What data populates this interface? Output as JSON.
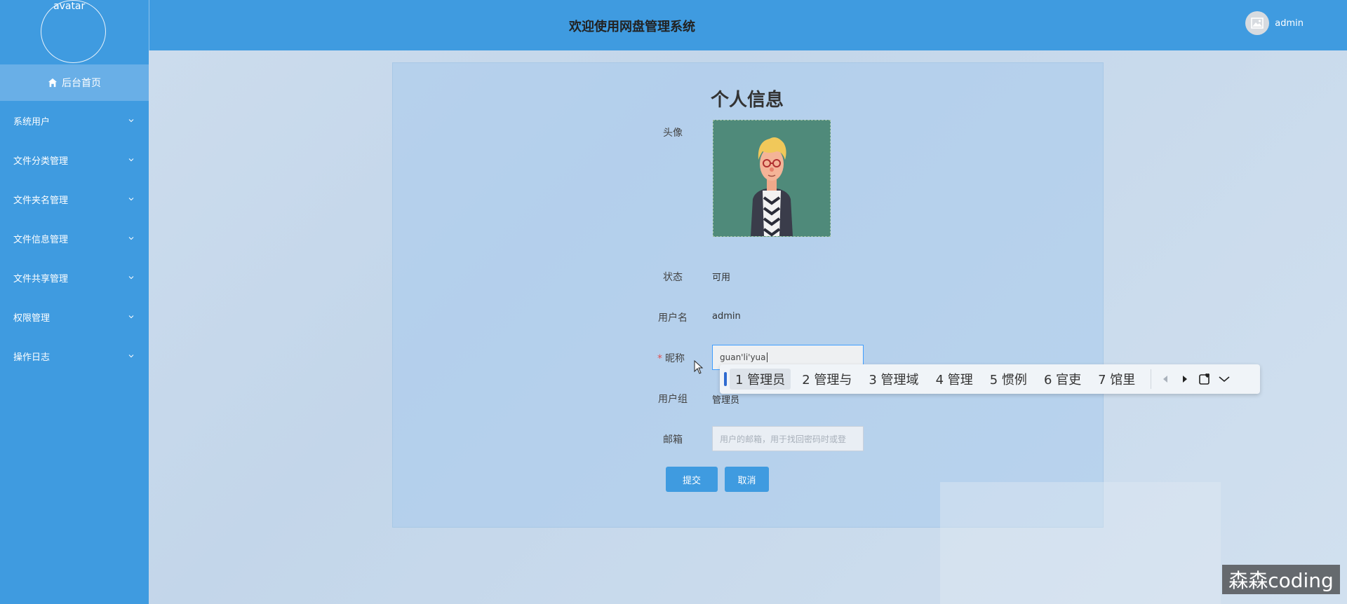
{
  "sidebar": {
    "avatar_alt": "avatar",
    "home_label": "后台首页",
    "items": [
      {
        "label": "系统用户"
      },
      {
        "label": "文件分类管理"
      },
      {
        "label": "文件夹名管理"
      },
      {
        "label": "文件信息管理"
      },
      {
        "label": "文件共享管理"
      },
      {
        "label": "权限管理"
      },
      {
        "label": "操作日志"
      }
    ]
  },
  "header": {
    "title": "欢迎使用网盘管理系统",
    "username": "admin"
  },
  "profile": {
    "title": "个人信息",
    "avatar_label": "头像",
    "status_label": "状态",
    "status_value": "可用",
    "username_label": "用户名",
    "username_value": "admin",
    "nickname_required_mark": "*",
    "nickname_label": "昵称",
    "nickname_value": "guan'li'yua",
    "group_label": "用户组",
    "group_value": "管理员",
    "email_label": "邮箱",
    "email_placeholder": "用户的邮箱，用于找回密码时或登",
    "submit_label": "提交",
    "cancel_label": "取消"
  },
  "ime": {
    "candidates": [
      "1 管理员",
      "2 管理与",
      "3 管理域",
      "4 管理",
      "5 惯例",
      "6 官吏",
      "7 馆里"
    ],
    "selected_index": 0
  },
  "watermark": "森森coding",
  "colors": {
    "primary": "#3f9be0",
    "home_active": "#69afe7",
    "required": "#e05050"
  }
}
